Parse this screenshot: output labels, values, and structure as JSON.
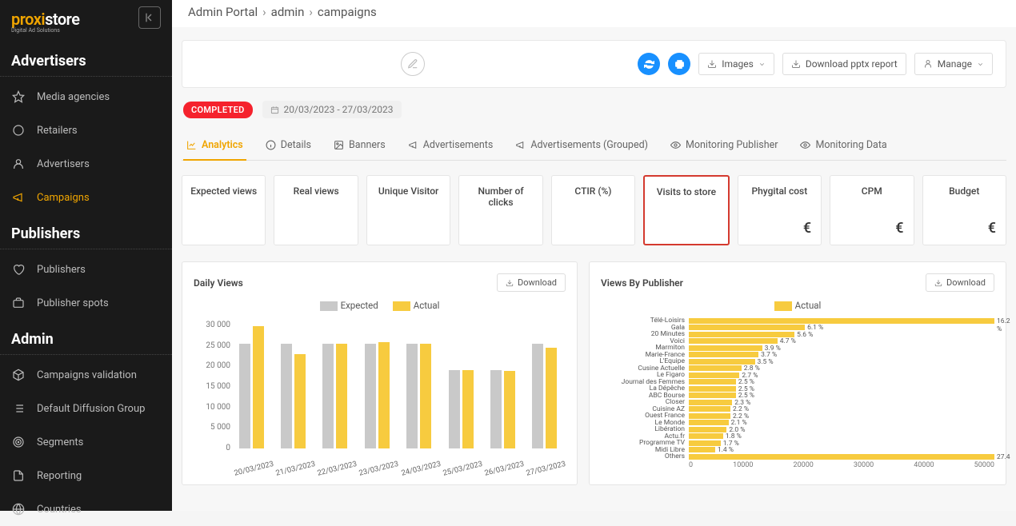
{
  "logo": {
    "brand_left": "proxi",
    "brand_right": "store",
    "tagline": "Digital Ad Solutions"
  },
  "breadcrumb": [
    "Admin Portal",
    "admin",
    "campaigns"
  ],
  "header": {
    "images_btn": "Images",
    "download_btn": "Download pptx report",
    "manage_btn": "Manage"
  },
  "status": {
    "completed": "COMPLETED",
    "date_range": "20/03/2023 - 27/03/2023"
  },
  "sidebar": {
    "sections": [
      {
        "title": "Advertisers",
        "items": [
          {
            "label": "Media agencies",
            "icon": "star"
          },
          {
            "label": "Retailers",
            "icon": "circle"
          },
          {
            "label": "Advertisers",
            "icon": "user"
          },
          {
            "label": "Campaigns",
            "icon": "megaphone",
            "active": true
          }
        ]
      },
      {
        "title": "Publishers",
        "items": [
          {
            "label": "Publishers",
            "icon": "heart"
          },
          {
            "label": "Publisher spots",
            "icon": "briefcase"
          }
        ]
      },
      {
        "title": "Admin",
        "items": [
          {
            "label": "Campaigns validation",
            "icon": "cube"
          },
          {
            "label": "Default Diffusion Group",
            "icon": "list"
          },
          {
            "label": "Segments",
            "icon": "target"
          },
          {
            "label": "Reporting",
            "icon": "file"
          },
          {
            "label": "Countries",
            "icon": "globe"
          }
        ]
      }
    ]
  },
  "tabs": [
    {
      "label": "Analytics",
      "icon": "chart",
      "active": true
    },
    {
      "label": "Details",
      "icon": "info"
    },
    {
      "label": "Banners",
      "icon": "image"
    },
    {
      "label": "Advertisements",
      "icon": "megaphone"
    },
    {
      "label": "Advertisements (Grouped)",
      "icon": "megaphone"
    },
    {
      "label": "Monitoring Publisher",
      "icon": "eye"
    },
    {
      "label": "Monitoring Data",
      "icon": "eye"
    }
  ],
  "kpis": [
    {
      "label": "Expected views",
      "value": ""
    },
    {
      "label": "Real views",
      "value": ""
    },
    {
      "label": "Unique Visitor",
      "value": ""
    },
    {
      "label": "Number of clicks",
      "value": ""
    },
    {
      "label": "CTIR (%)",
      "value": ""
    },
    {
      "label": "Visits to store",
      "value": "",
      "highlight": true
    },
    {
      "label": "Phygital cost",
      "value": "€"
    },
    {
      "label": "CPM",
      "value": "€"
    },
    {
      "label": "Budget",
      "value": "€"
    }
  ],
  "daily_views": {
    "title": "Daily Views",
    "download": "Download",
    "legend": {
      "expected": "Expected",
      "actual": "Actual"
    },
    "colors": {
      "expected": "#c9c9c9",
      "actual": "#f7cb3f"
    }
  },
  "publisher_views": {
    "title": "Views By Publisher",
    "download": "Download",
    "legend": {
      "actual": "Actual"
    },
    "color": "#f7cb3f"
  },
  "chart_data": [
    {
      "type": "bar",
      "title": "Daily Views",
      "categories": [
        "20/03/2023",
        "21/03/2023",
        "22/03/2023",
        "23/03/2023",
        "24/03/2023",
        "25/03/2023",
        "26/03/2023",
        "27/03/2023"
      ],
      "series": [
        {
          "name": "Expected",
          "values": [
            24000,
            24000,
            24000,
            24000,
            24000,
            18000,
            18000,
            24000
          ]
        },
        {
          "name": "Actual",
          "values": [
            28000,
            21500,
            24000,
            24300,
            24000,
            18000,
            17800,
            23000
          ]
        }
      ],
      "ylim": [
        0,
        30000
      ],
      "y_ticks": [
        0,
        5000,
        10000,
        15000,
        20000,
        25000,
        30000
      ],
      "y_tick_labels": [
        "0",
        "5 000",
        "10 000",
        "15 000",
        "20 000",
        "25 000",
        "30 000"
      ]
    },
    {
      "type": "bar_horizontal",
      "title": "Views By Publisher",
      "series_name": "Actual",
      "xlim": [
        0,
        50000
      ],
      "x_ticks": [
        0,
        10000,
        20000,
        30000,
        40000,
        50000
      ],
      "rows": [
        {
          "label": "Télé-Loisirs",
          "value": 50000,
          "pct": "16.2 %"
        },
        {
          "label": "Gala",
          "value": 19000,
          "pct": "6.1 %"
        },
        {
          "label": "20 Minutes",
          "value": 17300,
          "pct": "5.6 %"
        },
        {
          "label": "Voici",
          "value": 14500,
          "pct": "4.7 %"
        },
        {
          "label": "Marmiton",
          "value": 12000,
          "pct": "3.9 %"
        },
        {
          "label": "Marie-France",
          "value": 11400,
          "pct": "3.7 %"
        },
        {
          "label": "L'Equipe",
          "value": 10800,
          "pct": "3.5 %"
        },
        {
          "label": "Cusine Actuelle",
          "value": 8600,
          "pct": "2.8 %"
        },
        {
          "label": "Le Figaro",
          "value": 8300,
          "pct": "2.7 %"
        },
        {
          "label": "Journal des Femmes",
          "value": 7700,
          "pct": "2.5 %"
        },
        {
          "label": "La Dépêche",
          "value": 7700,
          "pct": "2.5 %"
        },
        {
          "label": "ABC Bourse",
          "value": 7700,
          "pct": "2.5 %"
        },
        {
          "label": "Closer",
          "value": 7100,
          "pct": "2.3 %"
        },
        {
          "label": "Cuisine AZ",
          "value": 6800,
          "pct": "2.2 %"
        },
        {
          "label": "Ouest France",
          "value": 6800,
          "pct": "2.2 %"
        },
        {
          "label": "Le Monde",
          "value": 6500,
          "pct": "2.1 %"
        },
        {
          "label": "Libération",
          "value": 6200,
          "pct": "2.0 %"
        },
        {
          "label": "Actu.fr",
          "value": 5600,
          "pct": "1.8 %"
        },
        {
          "label": "Programme TV",
          "value": 5200,
          "pct": "1.7 %"
        },
        {
          "label": "Midi Libre",
          "value": 4300,
          "pct": "1.4 %"
        },
        {
          "label": "Others",
          "value": 50000,
          "pct": "27.4"
        }
      ]
    }
  ]
}
